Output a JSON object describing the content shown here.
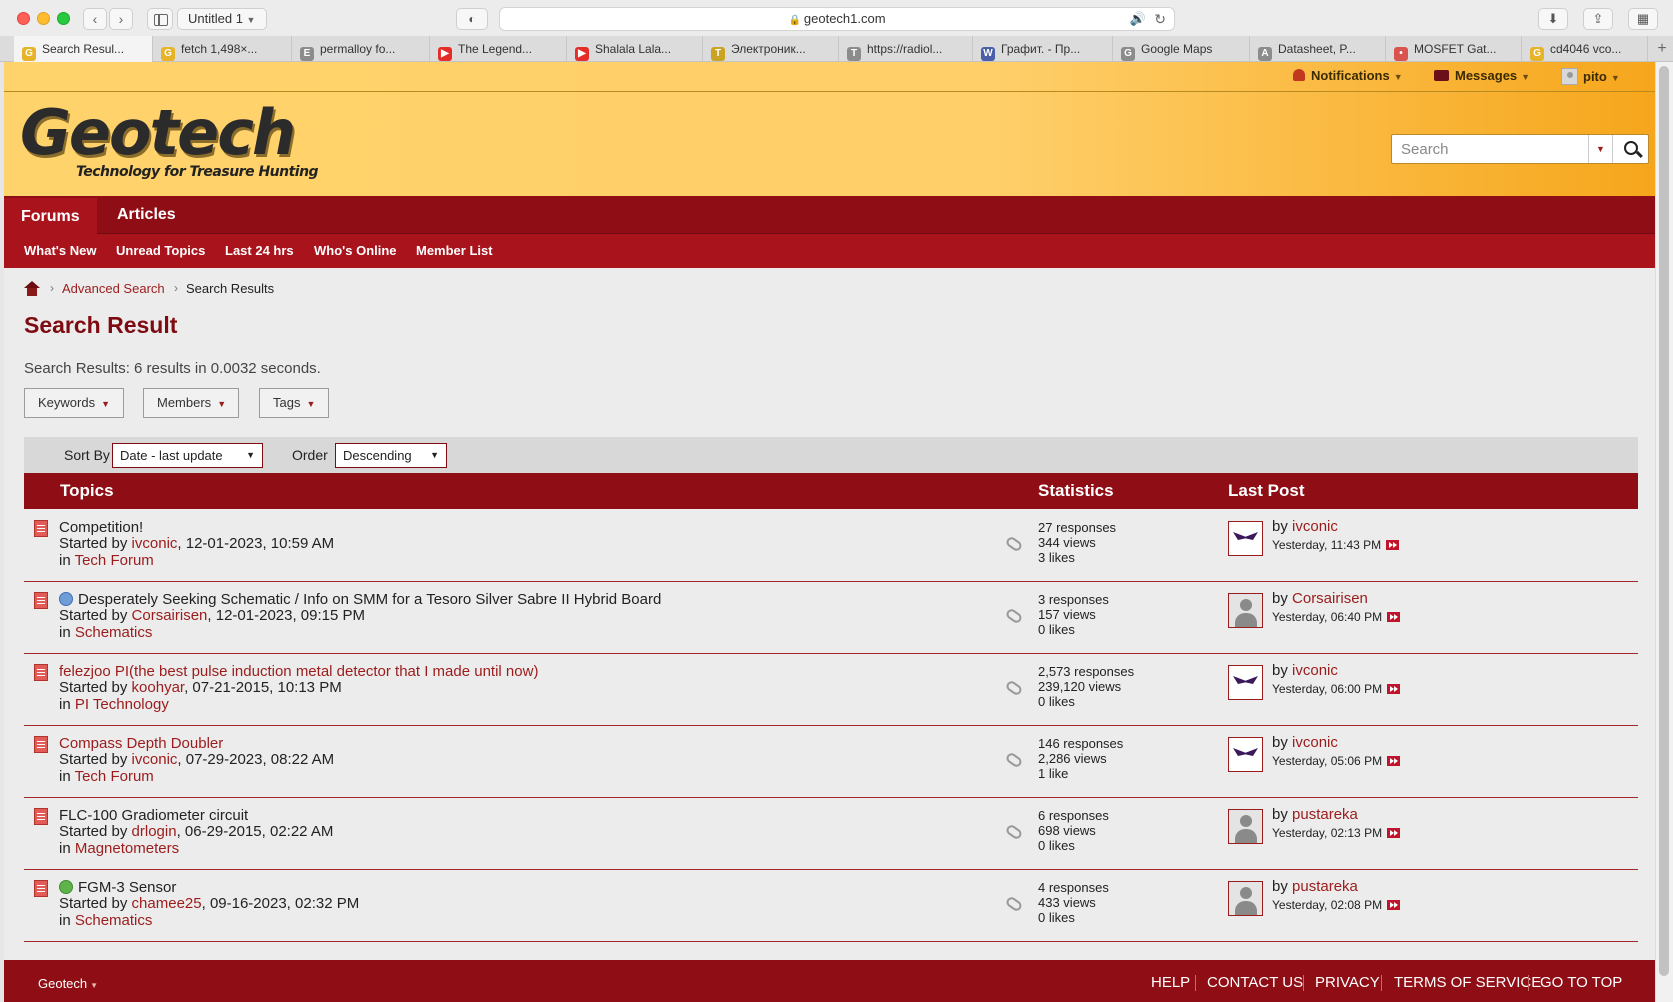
{
  "browser": {
    "tab_group_label": "Untitled 1",
    "url": "geotech1.com",
    "tabs": [
      {
        "title": "Search Resul...",
        "icon": "google-icon",
        "color": "#e7b328",
        "glyph": "G"
      },
      {
        "title": "fetch 1,498×...",
        "icon": "google-icon",
        "color": "#e7b328",
        "glyph": "G"
      },
      {
        "title": "permalloy fo...",
        "icon": "generic-page-icon",
        "color": "#8c8c8c",
        "glyph": "E"
      },
      {
        "title": "The Legend...",
        "icon": "youtube-icon",
        "color": "#e52d27",
        "glyph": "▶"
      },
      {
        "title": "Shalala Lala...",
        "icon": "youtube-icon",
        "color": "#e52d27",
        "glyph": "▶"
      },
      {
        "title": "Электроник...",
        "icon": "radio-icon",
        "color": "#c9a321",
        "glyph": "T"
      },
      {
        "title": "https://radiol...",
        "icon": "generic-page-icon",
        "color": "#8c8c8c",
        "glyph": "T"
      },
      {
        "title": "Графит. - Пр...",
        "icon": "wiki-icon",
        "color": "#4b5fa8",
        "glyph": "W"
      },
      {
        "title": "Google Maps",
        "icon": "maps-icon",
        "color": "#8c8c8c",
        "glyph": "G"
      },
      {
        "title": "Datasheet, P...",
        "icon": "generic-page-icon",
        "color": "#8c8c8c",
        "glyph": "A"
      },
      {
        "title": "MOSFET Gat...",
        "icon": "site-icon",
        "color": "#d9534f",
        "glyph": "•"
      },
      {
        "title": "cd4046 vco...",
        "icon": "google-icon",
        "color": "#e7b328",
        "glyph": "G"
      }
    ]
  },
  "userbar": {
    "notifications": "Notifications",
    "messages": "Messages",
    "username": "pito"
  },
  "logo": {
    "name": "Geotech",
    "tagline": "Technology for Treasure Hunting"
  },
  "search": {
    "placeholder": "Search"
  },
  "nav": {
    "primary": [
      "Forums",
      "Articles"
    ],
    "secondary": [
      "What's New",
      "Unread Topics",
      "Last 24 hrs",
      "Who's Online",
      "Member List"
    ]
  },
  "breadcrumb": {
    "link": "Advanced Search",
    "current": "Search Results"
  },
  "page": {
    "title": "Search Result",
    "summary": "Search Results: 6 results in 0.0032 seconds."
  },
  "filters": [
    "Keywords",
    "Members",
    "Tags"
  ],
  "sort": {
    "sort_by_label": "Sort By",
    "sort_by_value": "Date - last update",
    "order_label": "Order",
    "order_value": "Descending"
  },
  "table": {
    "headers": {
      "topics": "Topics",
      "statistics": "Statistics",
      "last_post": "Last Post"
    },
    "started_by_prefix": "Started by",
    "in_prefix": "in",
    "by_prefix": "by",
    "rows": [
      {
        "title": "Competition!",
        "title_style": "plain",
        "prefix_icon": "",
        "author": "ivconic",
        "date": ", 12-01-2023, 10:59 AM",
        "forum": "Tech Forum",
        "responses": "27 responses",
        "views": "344 views",
        "likes": "3 likes",
        "avatar": "wings",
        "last_user": "ivconic",
        "last_time": "Yesterday, 11:43 PM"
      },
      {
        "title": "Desperately Seeking Schematic / Info on SMM for a Tesoro Silver Sabre II Hybrid Board",
        "title_style": "plain",
        "prefix_icon": "info",
        "author": "Corsairisen",
        "date": ", 12-01-2023, 09:15 PM",
        "forum": "Schematics",
        "responses": "3 responses",
        "views": "157 views",
        "likes": "0 likes",
        "avatar": "person",
        "last_user": "Corsairisen",
        "last_time": "Yesterday, 06:40 PM"
      },
      {
        "title": "felezjoo PI(the best pulse induction metal detector that I made until now)",
        "title_style": "link",
        "prefix_icon": "",
        "author": "koohyar",
        "date": ", 07-21-2015, 10:13 PM",
        "forum": "PI Technology",
        "responses": "2,573 responses",
        "views": "239,120 views",
        "likes": "0 likes",
        "avatar": "wings",
        "last_user": "ivconic",
        "last_time": "Yesterday, 06:00 PM"
      },
      {
        "title": "Compass Depth Doubler",
        "title_style": "link",
        "prefix_icon": "",
        "author": "ivconic",
        "date": ", 07-29-2023, 08:22 AM",
        "forum": "Tech Forum",
        "responses": "146 responses",
        "views": "2,286 views",
        "likes": "1 like",
        "avatar": "wings",
        "last_user": "ivconic",
        "last_time": "Yesterday, 05:06 PM"
      },
      {
        "title": "FLC-100 Gradiometer circuit",
        "title_style": "plain",
        "prefix_icon": "",
        "author": "drlogin",
        "date": ", 06-29-2015, 02:22 AM",
        "forum": "Magnetometers",
        "responses": "6 responses",
        "views": "698 views",
        "likes": "0 likes",
        "avatar": "person",
        "last_user": "pustareka",
        "last_time": "Yesterday, 02:13 PM"
      },
      {
        "title": "FGM-3 Sensor",
        "title_style": "plain",
        "prefix_icon": "solved",
        "author": "chamee25",
        "date": ", 09-16-2023, 02:32 PM",
        "forum": "Schematics",
        "responses": "4 responses",
        "views": "433 views",
        "likes": "0 likes",
        "avatar": "person",
        "last_user": "pustareka",
        "last_time": "Yesterday, 02:08 PM"
      }
    ]
  },
  "footer": {
    "brand": "Geotech",
    "links": [
      "HELP",
      "CONTACT US",
      "PRIVACY",
      "TERMS OF SERVICE",
      "GO TO TOP"
    ]
  }
}
